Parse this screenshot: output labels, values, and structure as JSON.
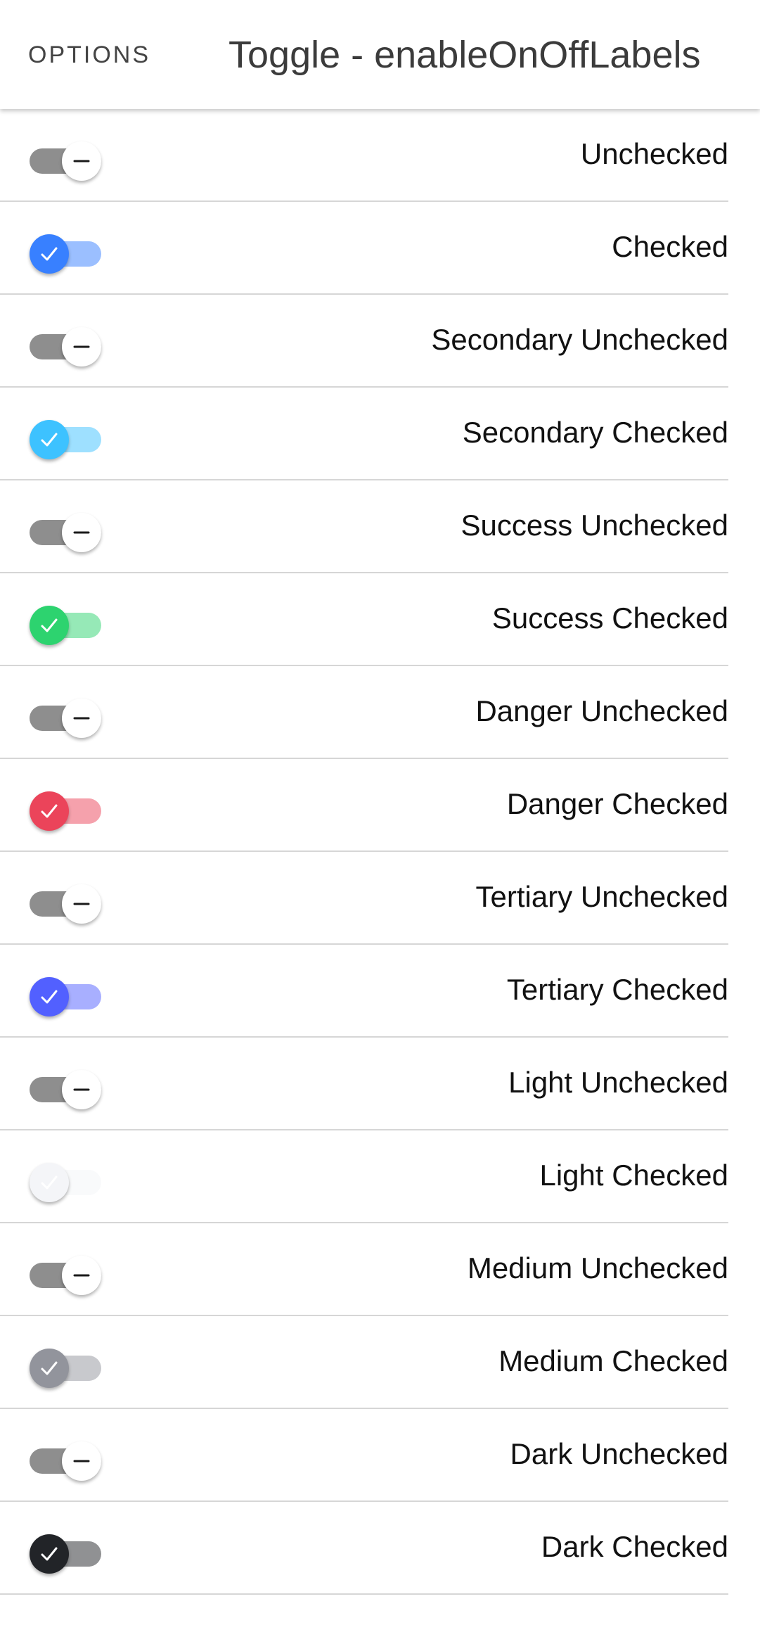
{
  "header": {
    "options_label": "OPTIONS",
    "title": "Toggle - enableOnOffLabels"
  },
  "toggles": [
    {
      "label": "Unchecked",
      "checked": false,
      "color": "#3880ff"
    },
    {
      "label": "Checked",
      "checked": true,
      "color": "#3880ff"
    },
    {
      "label": "Secondary Unchecked",
      "checked": false,
      "color": "#3dc2ff"
    },
    {
      "label": "Secondary Checked",
      "checked": true,
      "color": "#3dc2ff"
    },
    {
      "label": "Success Unchecked",
      "checked": false,
      "color": "#2dd36f"
    },
    {
      "label": "Success Checked",
      "checked": true,
      "color": "#2dd36f"
    },
    {
      "label": "Danger Unchecked",
      "checked": false,
      "color": "#eb445a"
    },
    {
      "label": "Danger Checked",
      "checked": true,
      "color": "#eb445a"
    },
    {
      "label": "Tertiary Unchecked",
      "checked": false,
      "color": "#5260ff"
    },
    {
      "label": "Tertiary Checked",
      "checked": true,
      "color": "#5260ff"
    },
    {
      "label": "Light Unchecked",
      "checked": false,
      "color": "#f4f5f8"
    },
    {
      "label": "Light Checked",
      "checked": true,
      "color": "#f4f5f8"
    },
    {
      "label": "Medium Unchecked",
      "checked": false,
      "color": "#92949c"
    },
    {
      "label": "Medium Checked",
      "checked": true,
      "color": "#92949c"
    },
    {
      "label": "Dark Unchecked",
      "checked": false,
      "color": "#222428"
    },
    {
      "label": "Dark Checked",
      "checked": true,
      "color": "#222428"
    }
  ],
  "colors": {
    "off_track": "#8e8e8e",
    "off_knob": "#ffffff",
    "divider": "#d6d6d6",
    "on_icon": "checkmark-icon",
    "off_icon": "minus-icon"
  }
}
